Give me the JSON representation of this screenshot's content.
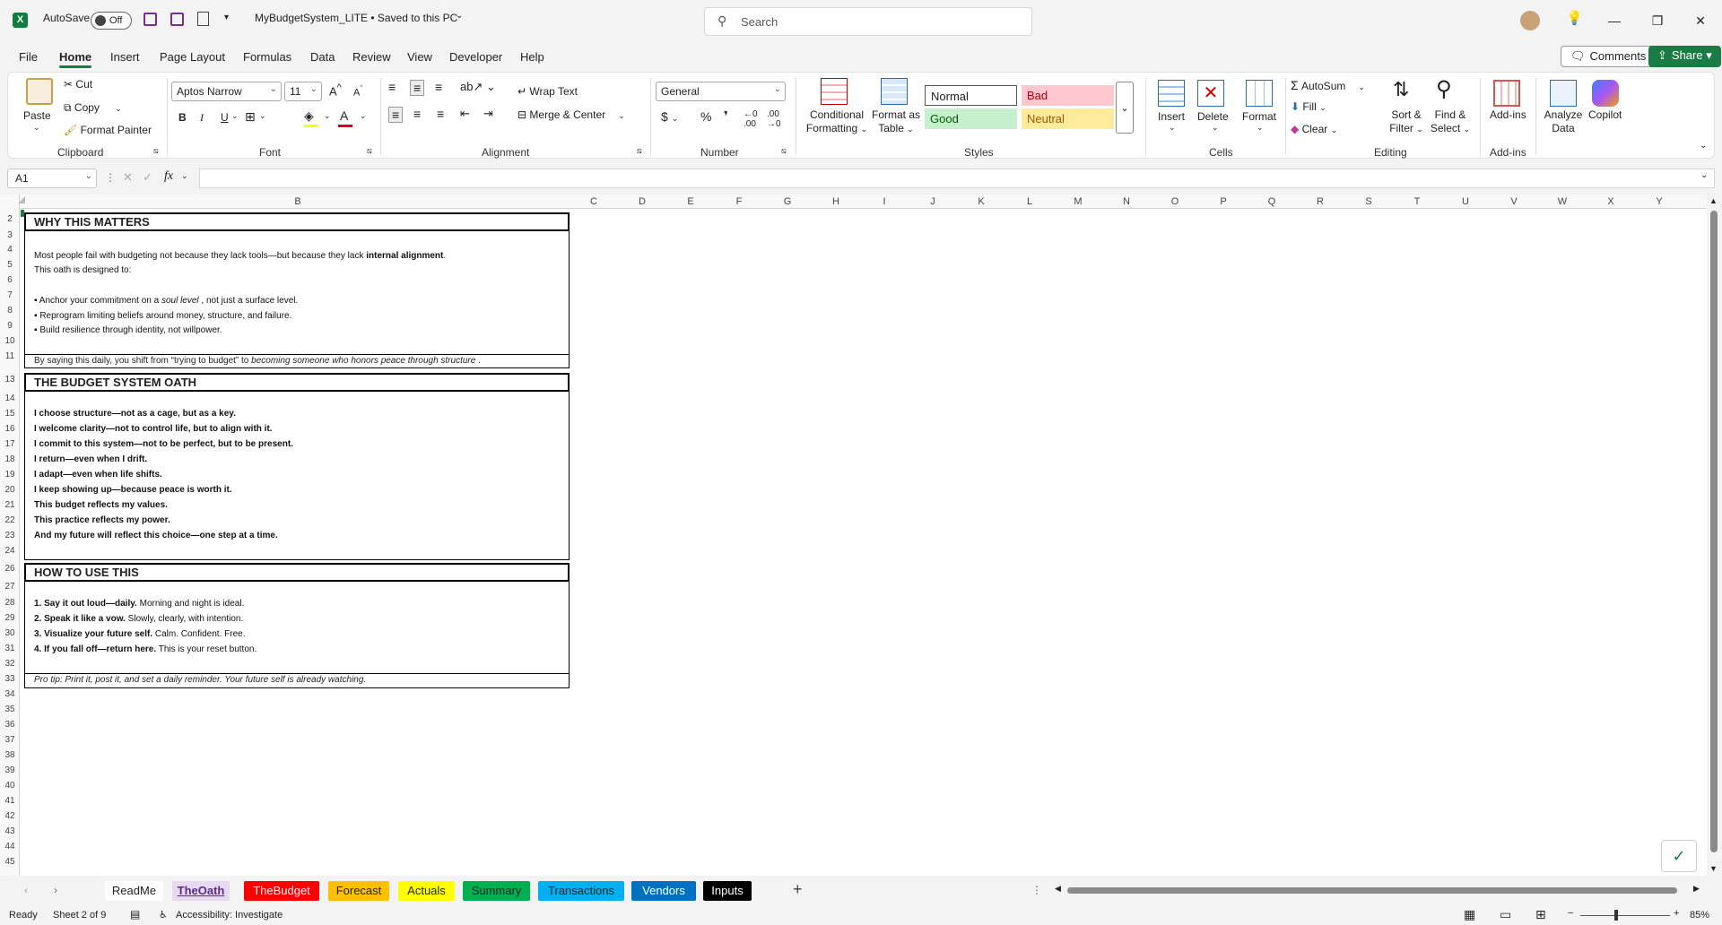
{
  "titlebar": {
    "autosave_label": "AutoSave",
    "autosave_state": "Off",
    "doc_title": "MyBudgetSystem_LITE • Saved to this PC",
    "search_placeholder": "Search"
  },
  "menu": {
    "tabs": [
      "File",
      "Home",
      "Insert",
      "Page Layout",
      "Formulas",
      "Data",
      "Review",
      "View",
      "Developer",
      "Help"
    ],
    "active": "Home",
    "comments_label": "Comments",
    "share_label": "Share"
  },
  "ribbon": {
    "clipboard": {
      "paste": "Paste",
      "cut": "Cut",
      "copy": "Copy",
      "format_painter": "Format Painter",
      "label": "Clipboard"
    },
    "font": {
      "name": "Aptos Narrow",
      "size": "11",
      "label": "Font"
    },
    "alignment": {
      "wrap": "Wrap Text",
      "merge": "Merge & Center",
      "label": "Alignment"
    },
    "number": {
      "format": "General",
      "label": "Number"
    },
    "styles": {
      "conditional": [
        "Conditional",
        "Formatting"
      ],
      "format_table": [
        "Format as",
        "Table"
      ],
      "normal": "Normal",
      "bad": "Bad",
      "good": "Good",
      "neutral": "Neutral",
      "label": "Styles"
    },
    "cells": {
      "insert": "Insert",
      "delete": "Delete",
      "format": "Format",
      "label": "Cells"
    },
    "editing": {
      "autosum": "AutoSum",
      "fill": "Fill",
      "clear": "Clear",
      "sort": [
        "Sort &",
        "Filter"
      ],
      "find": [
        "Find &",
        "Select"
      ],
      "label": "Editing"
    },
    "addins": {
      "addins": "Add-ins",
      "label": "Add-ins"
    },
    "analyze": [
      "Analyze",
      "Data"
    ],
    "copilot": "Copilot"
  },
  "formula_bar": {
    "name_box": "A1",
    "fx": "fx",
    "value": ""
  },
  "columns": [
    "B",
    "C",
    "D",
    "E",
    "F",
    "G",
    "H",
    "I",
    "J",
    "K",
    "L",
    "M",
    "N",
    "O",
    "P",
    "Q",
    "R",
    "S",
    "T",
    "U",
    "V",
    "W",
    "X",
    "Y"
  ],
  "rows": [
    "2",
    "3",
    "4",
    "5",
    "6",
    "7",
    "8",
    "9",
    "10",
    "11",
    "13",
    "14",
    "15",
    "16",
    "17",
    "18",
    "19",
    "20",
    "21",
    "22",
    "23",
    "24",
    "26",
    "27",
    "28",
    "29",
    "30",
    "31",
    "32",
    "33",
    "34",
    "35",
    "36",
    "37",
    "38",
    "39",
    "40",
    "41",
    "42",
    "43",
    "44",
    "45"
  ],
  "sheet": {
    "why_title": "WHY THIS MATTERS",
    "why_line1_a": "Most people fail with budgeting not because they lack tools—but because they lack ",
    "why_line1_b": "internal alignment",
    "why_line1_c": ".",
    "why_line2": "This oath is designed to:",
    "why_bullet1_a": "▪ Anchor your commitment on a ",
    "why_bullet1_b": "soul level",
    "why_bullet1_c": " , not just a surface level.",
    "why_bullet2": "▪ Reprogram limiting beliefs around money, structure, and failure.",
    "why_bullet3": "▪ Build resilience through identity, not willpower.",
    "why_note_a": "By saying this daily, you shift from “trying to budget” to ",
    "why_note_b": "becoming someone who honors peace through structure",
    "why_note_c": " .",
    "oath_title": "THE BUDGET SYSTEM OATH",
    "oath_lines": [
      "I choose structure—not as a cage, but as a key.",
      "I welcome clarity—not to control life, but to align with it.",
      "I commit to this system—not to be perfect, but to be present.",
      "I return—even when I drift.",
      "I adapt—even when life shifts.",
      "I keep showing up—because peace is worth it.",
      "This budget reflects my values.",
      "This practice reflects my power.",
      "And my future will reflect this choice—one step at a time."
    ],
    "howto_title": "HOW TO USE THIS",
    "howto": [
      {
        "b": "1. Say it out loud—daily.",
        "t": " Morning and night is ideal."
      },
      {
        "b": "2. Speak it like a vow.",
        "t": " Slowly, clearly, with intention."
      },
      {
        "b": "3. Visualize your future self.",
        "t": " Calm. Confident. Free."
      },
      {
        "b": "4. If you fall off—return here.",
        "t": " This is your reset button."
      }
    ],
    "pro_tip": "Pro tip: Print it, post it, and set a daily reminder. Your future self is already watching."
  },
  "tabs": [
    {
      "label": "ReadMe",
      "bg": "#ffffff",
      "fg": "#222222"
    },
    {
      "label": "TheOath",
      "bg": "#e8d9f3",
      "fg": "#222222",
      "active": true
    },
    {
      "label": "TheBudget",
      "bg": "#ff0000",
      "fg": "#ffffff"
    },
    {
      "label": "Forecast",
      "bg": "#ffc000",
      "fg": "#222222"
    },
    {
      "label": "Actuals",
      "bg": "#ffff00",
      "fg": "#222222"
    },
    {
      "label": "Summary",
      "bg": "#00b050",
      "fg": "#222222"
    },
    {
      "label": "Transactions",
      "bg": "#00b0f0",
      "fg": "#222222"
    },
    {
      "label": "Vendors",
      "bg": "#0070c0",
      "fg": "#ffffff"
    },
    {
      "label": "Inputs",
      "bg": "#000000",
      "fg": "#ffffff"
    }
  ],
  "status": {
    "ready": "Ready",
    "sheet_info": "Sheet 2 of 9",
    "accessibility": "Accessibility: Investigate",
    "zoom": "85%"
  },
  "colors": {
    "accent": "#1b7b45",
    "share": "#1b7b45"
  }
}
